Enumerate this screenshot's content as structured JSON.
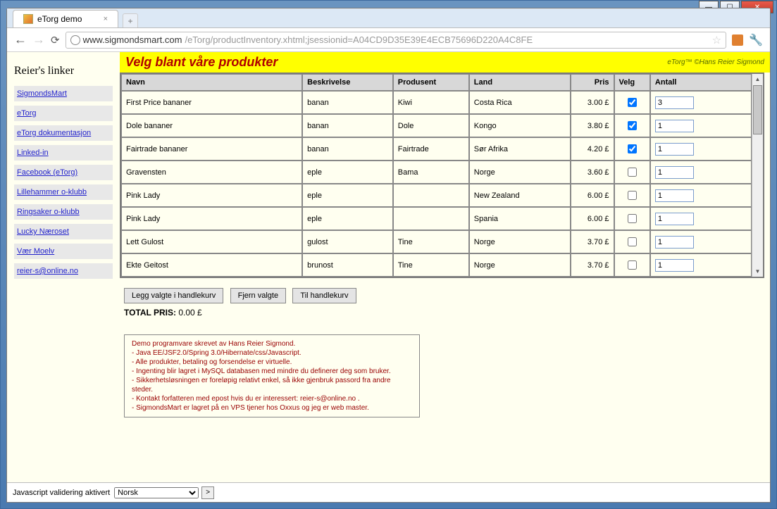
{
  "browser": {
    "tab_title": "eTorg demo",
    "url_host": "www.sigmondsmart.com",
    "url_path": "/eTorg/productInventory.xhtml;jsessionid=A04CD9D35E39E4ECB75696D220A4C8FE"
  },
  "sidebar": {
    "title": "Reier's linker",
    "links": [
      "SigmondsMart",
      "eTorg",
      "eTorg dokumentasjon",
      "Linked-in",
      "Facebook (eTorg)",
      "Lillehammer o-klubb",
      "Ringsaker o-klubb",
      "Lucky Næroset",
      "Vær Moelv",
      "reier-s@online.no"
    ]
  },
  "heading": {
    "title": "Velg blant våre produkter",
    "credit": "eTorg™ ©Hans Reier Sigmond"
  },
  "columns": {
    "name": "Navn",
    "desc": "Beskrivelse",
    "prod": "Produsent",
    "land": "Land",
    "price": "Pris",
    "select": "Velg",
    "qty": "Antall"
  },
  "rows": [
    {
      "name": "First Price bananer",
      "desc": "banan",
      "prod": "Kiwi",
      "land": "Costa Rica",
      "price": "3.00 £",
      "checked": true,
      "qty": "3"
    },
    {
      "name": "Dole bananer",
      "desc": "banan",
      "prod": "Dole",
      "land": "Kongo",
      "price": "3.80 £",
      "checked": true,
      "qty": "1"
    },
    {
      "name": "Fairtrade bananer",
      "desc": "banan",
      "prod": "Fairtrade",
      "land": "Sør Afrika",
      "price": "4.20 £",
      "checked": true,
      "qty": "1"
    },
    {
      "name": "Gravensten",
      "desc": "eple",
      "prod": "Bama",
      "land": "Norge",
      "price": "3.60 £",
      "checked": false,
      "qty": "1"
    },
    {
      "name": "Pink Lady",
      "desc": "eple",
      "prod": "",
      "land": "New Zealand",
      "price": "6.00 £",
      "checked": false,
      "qty": "1"
    },
    {
      "name": "Pink Lady",
      "desc": "eple",
      "prod": "",
      "land": "Spania",
      "price": "6.00 £",
      "checked": false,
      "qty": "1"
    },
    {
      "name": "Lett Gulost",
      "desc": "gulost",
      "prod": "Tine",
      "land": "Norge",
      "price": "3.70 £",
      "checked": false,
      "qty": "1"
    },
    {
      "name": "Ekte Geitost",
      "desc": "brunost",
      "prod": "Tine",
      "land": "Norge",
      "price": "3.70 £",
      "checked": false,
      "qty": "1"
    }
  ],
  "actions": {
    "add": "Legg valgte i handlekurv",
    "remove": "Fjern valgte",
    "cart": "Til handlekurv"
  },
  "total": {
    "label": "TOTAL PRIS:",
    "value": "0.00 £"
  },
  "info": [
    "Demo programvare skrevet av Hans Reier Sigmond.",
    "- Java EE/JSF2.0/Spring 3.0/Hibernate/css/Javascript.",
    "- Alle produkter, betaling og forsendelse er virtuelle.",
    "- Ingenting blir lagret i MySQL databasen med mindre du definerer deg som bruker.",
    "- Sikkerhetsløsningen er foreløpig relativt enkel, så ikke gjenbruk passord fra andre steder.",
    "- Kontakt forfatteren med epost hvis du er interessert: reier-s@online.no .",
    "- SigmondsMart er lagret på en VPS tjener hos Oxxus og jeg er web master."
  ],
  "footer": {
    "msg": "Javascript validering aktivert",
    "lang": "Norsk"
  }
}
